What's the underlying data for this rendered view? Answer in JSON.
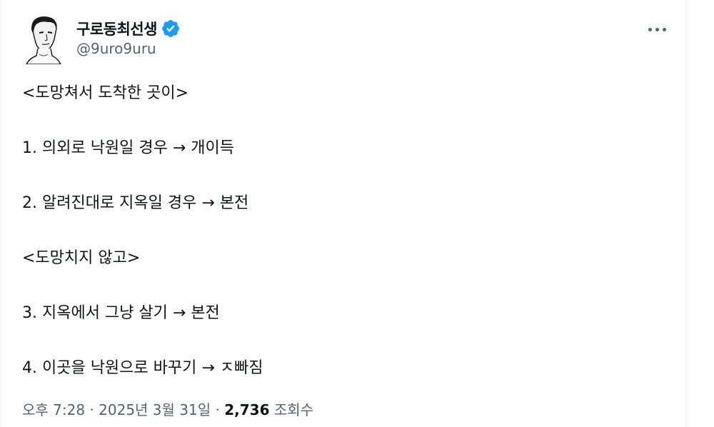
{
  "author": {
    "display_name": "구로동최선생",
    "handle": "@9uro9uru",
    "verified_color": "#1d9bf0"
  },
  "tweet": {
    "lines": [
      "<도망쳐서 도착한 곳이>",
      "",
      "1. 의외로 낙원일 경우 → 개이득",
      "",
      "2. 알려진대로 지옥일 경우 → 본전",
      "",
      "<도망치지 않고>",
      "",
      "3. 지옥에서 그냥 살기 → 본전",
      "",
      "4. 이곳을 낙원으로 바꾸기 → ㅈ빠짐"
    ]
  },
  "meta": {
    "time": "오후 7:28",
    "separator": " · ",
    "date": "2025년 3월 31일",
    "views_count": "2,736",
    "views_label": "조회수"
  },
  "icons": {
    "avatar": "avatar-sketch-portrait",
    "verified": "verified-badge-icon",
    "more": "more-options-icon"
  }
}
